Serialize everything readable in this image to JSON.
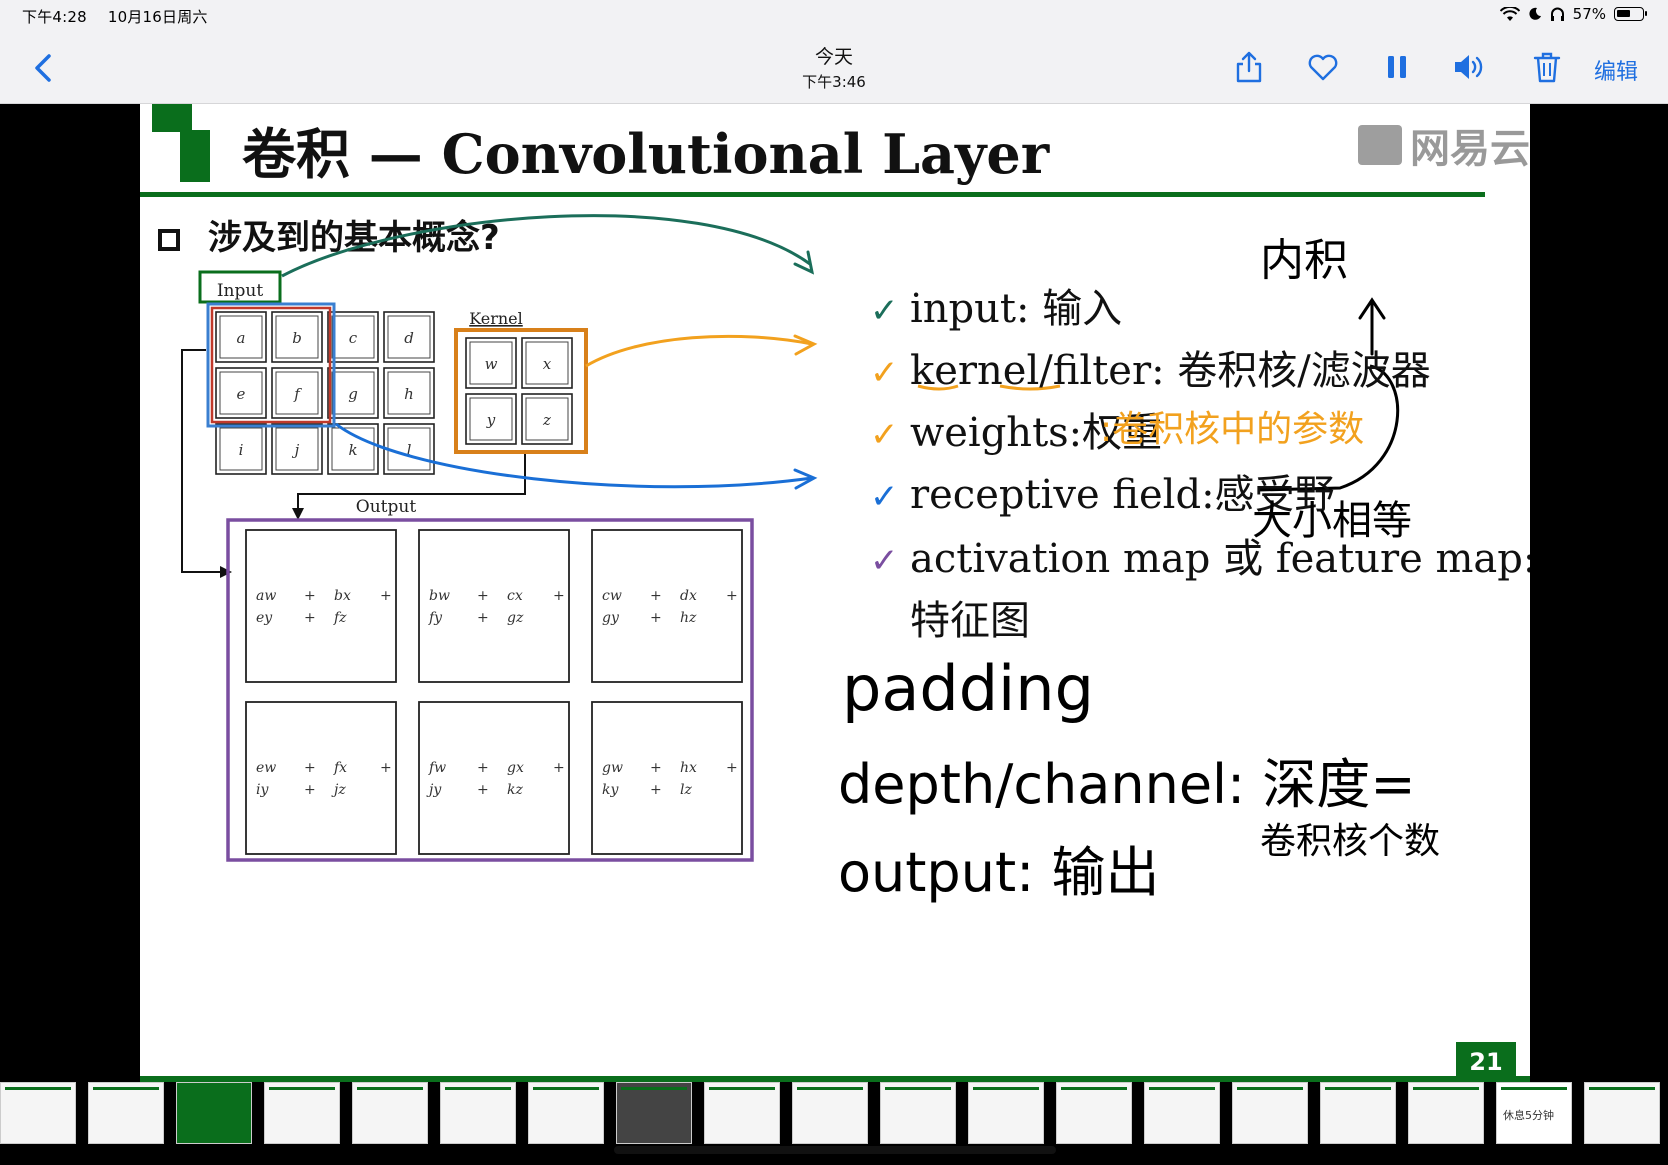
{
  "status_bar": {
    "time": "下午4:28",
    "date": "10月16日周六",
    "battery": "57%",
    "battery_level": 0.57
  },
  "toolbar": {
    "title": "今天",
    "subtitle": "下午3:46",
    "edit_label": "编辑",
    "icons": [
      "share-icon",
      "heart-icon",
      "pause-icon",
      "speaker-icon",
      "trash-icon"
    ]
  },
  "slide": {
    "title": "卷积 — Convolutional Layer",
    "brand": "网易云",
    "question": "涉及到的基本概念?",
    "page_number": "21",
    "diagram": {
      "input_label": "Input",
      "kernel_label": "Kernel",
      "output_label": "Output",
      "input_cells": [
        "a",
        "b",
        "c",
        "d",
        "e",
        "f",
        "g",
        "h",
        "i",
        "j",
        "k",
        "l"
      ],
      "kernel_cells": [
        "w",
        "x",
        "y",
        "z"
      ],
      "output_cells": [
        [
          "aw",
          "+",
          "bx",
          "+",
          "ey",
          "+",
          "fz"
        ],
        [
          "bw",
          "+",
          "cx",
          "+",
          "fy",
          "+",
          "gz"
        ],
        [
          "cw",
          "+",
          "dx",
          "+",
          "gy",
          "+",
          "hz"
        ],
        [
          "ew",
          "+",
          "fx",
          "+",
          "iy",
          "+",
          "jz"
        ],
        [
          "fw",
          "+",
          "gx",
          "+",
          "jy",
          "+",
          "kz"
        ],
        [
          "gw",
          "+",
          "hx",
          "+",
          "ky",
          "+",
          "lz"
        ]
      ]
    },
    "bullets": [
      "input: 输入",
      "kernel/filter: 卷积核/滤波器",
      "weights:权重",
      "receptive field:感受野",
      "activation map 或 feature map:",
      "特征图"
    ],
    "handwriting": {
      "weights_note": ":卷积核中的参数",
      "top_note": "内积",
      "size_note": "大小相等",
      "padding": "padding",
      "depth": "depth/channel: 深度=",
      "depth_note": "卷积核个数",
      "output": "output: 输出"
    }
  },
  "thumbnails": {
    "break_label": "休息5分钟"
  },
  "colors": {
    "brand_green": "#0a6e1c",
    "accent_blue": "#1f6fe0",
    "ink_orange": "#f2a11e",
    "ink_teal": "#1b6e5a",
    "ink_blue": "#1a6fd6",
    "kernel_orange": "#d8801a",
    "output_purple": "#7a4ea0"
  }
}
